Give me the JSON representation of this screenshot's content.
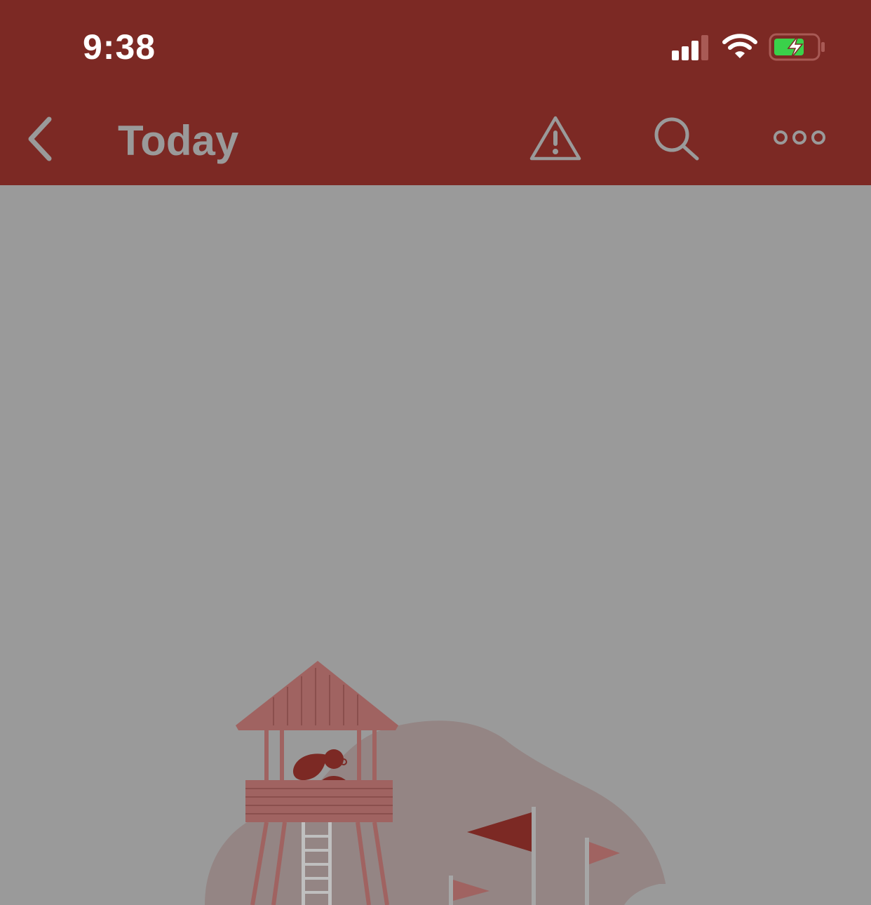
{
  "status_bar": {
    "time": "9:38",
    "signal_icon": "cellular-signal-icon",
    "wifi_icon": "wifi-icon",
    "battery_icon": "battery-charging-icon"
  },
  "nav": {
    "title": "Today",
    "back_icon": "chevron-left-icon",
    "warning_icon": "warning-icon",
    "search_icon": "search-icon",
    "more_icon": "more-icon"
  },
  "colors": {
    "bar": "#7c2924",
    "overlay": "#9a9a9a",
    "accent": "#7c2924"
  },
  "content": {
    "illustration": "lookout-tower-illustration"
  }
}
